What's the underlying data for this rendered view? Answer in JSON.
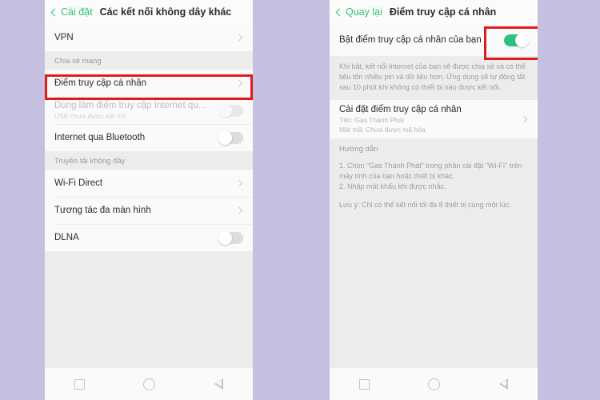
{
  "theme": {
    "page_background": "#c5bfe0",
    "accent_green": "#34c27a",
    "highlight_red": "#e01b1b",
    "toggle_on": "#2ec27e"
  },
  "left_screen": {
    "header": {
      "back_label": "Cài đặt",
      "title": "Các kết nối không dây khác"
    },
    "rows": {
      "vpn": {
        "title": "VPN",
        "accessory": "chevron"
      },
      "section_sharing": "Chia sẻ mạng",
      "hotspot": {
        "title": "Điểm truy cập cá nhân",
        "accessory": "chevron",
        "highlighted": true
      },
      "usb_tether": {
        "title": "Dùng làm điểm truy cập Internet qu...",
        "subtitle": "USB chưa được kết nối",
        "accessory": "toggle-off-disabled"
      },
      "bt_tether": {
        "title": "Internet qua Bluetooth",
        "accessory": "toggle-off"
      },
      "section_wireless": "Truyền tải không dây",
      "wifi_direct": {
        "title": "Wi-Fi Direct",
        "accessory": "chevron"
      },
      "multi_screen": {
        "title": "Tương tác đa màn hình",
        "accessory": "chevron"
      },
      "dlna": {
        "title": "DLNA",
        "accessory": "toggle-off"
      }
    },
    "navbar": {
      "recents": "recents-square-icon",
      "home": "home-circle-icon",
      "back": "back-triangle-icon"
    }
  },
  "right_screen": {
    "header": {
      "back_label": "Quay lại",
      "title": "Điểm truy cập cá nhân"
    },
    "enable_row": {
      "title": "Bật điểm truy cập cá nhân của bạn",
      "toggle_state": "on",
      "highlighted": true
    },
    "description": "Khi bật, kết nối Internet của bạn sẽ được chia sẻ và có thể tiêu tốn nhiều pin và dữ liệu hơn. Ứng dụng sẽ tự động tắt sau 10 phút khi không có thiết bị nào được kết nối.",
    "settings_row": {
      "title": "Cài đặt điểm truy cập cá nhân",
      "line1": "Tên: Gas Thành Phát",
      "line2": "Mật mã: Chưa được mã hóa",
      "accessory": "chevron"
    },
    "guide": {
      "title": "Hướng dẫn",
      "step1": "1. Chọn \"Gas Thành Phát\" trong phần cài đặt \"Wi-Fi\" trên máy tính của bạn hoặc thiết bị khác.",
      "step2": "2. Nhập mật khẩu khi được nhắc.",
      "note": "Lưu ý: Chỉ có thể kết nối tối đa 8 thiết bị cùng một lúc."
    },
    "navbar": {
      "recents": "recents-square-icon",
      "home": "home-circle-icon",
      "back": "back-triangle-icon"
    }
  }
}
